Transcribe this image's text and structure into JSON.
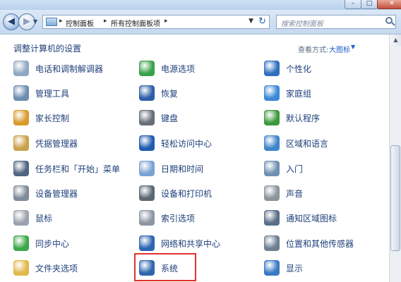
{
  "navbar": {
    "breadcrumbs": [
      "控制面板",
      "所有控制面板项"
    ],
    "search_placeholder": "搜索控制面板"
  },
  "header": {
    "title": "调整计算机的设置",
    "view_by_label": "查看方式:",
    "view_by_value": "大图标"
  },
  "items": [
    {
      "label": "电话和调制解调器",
      "icon": "phone-modem-icon",
      "color": "#8fa8c2"
    },
    {
      "label": "电源选项",
      "icon": "power-options-icon",
      "color": "#3aa14a"
    },
    {
      "label": "个性化",
      "icon": "personalization-icon",
      "color": "#2f6fbe"
    },
    {
      "label": "管理工具",
      "icon": "admin-tools-icon",
      "color": "#6e8db3"
    },
    {
      "label": "恢复",
      "icon": "recovery-icon",
      "color": "#2d5fa8"
    },
    {
      "label": "家庭组",
      "icon": "homegroup-icon",
      "color": "#3b89d6"
    },
    {
      "label": "家长控制",
      "icon": "parental-controls-icon",
      "color": "#d99a2b"
    },
    {
      "label": "键盘",
      "icon": "keyboard-icon",
      "color": "#666f7a"
    },
    {
      "label": "默认程序",
      "icon": "default-programs-icon",
      "color": "#3c9a3e"
    },
    {
      "label": "凭据管理器",
      "icon": "credential-manager-icon",
      "color": "#c9a14a"
    },
    {
      "label": "轻松访问中心",
      "icon": "ease-of-access-icon",
      "color": "#1f5cb0"
    },
    {
      "label": "区域和语言",
      "icon": "region-language-icon",
      "color": "#3f85c9"
    },
    {
      "label": "任务栏和「开始」菜单",
      "icon": "taskbar-icon",
      "color": "#4f6580"
    },
    {
      "label": "日期和时间",
      "icon": "date-time-icon",
      "color": "#7aa2d2"
    },
    {
      "label": "入门",
      "icon": "getting-started-icon",
      "color": "#6f8fb3"
    },
    {
      "label": "设备管理器",
      "icon": "device-manager-icon",
      "color": "#7f8b98"
    },
    {
      "label": "设备和打印机",
      "icon": "devices-printers-icon",
      "color": "#5c6774"
    },
    {
      "label": "声音",
      "icon": "sound-icon",
      "color": "#8b939b"
    },
    {
      "label": "鼠标",
      "icon": "mouse-icon",
      "color": "#9aa3ad"
    },
    {
      "label": "索引选项",
      "icon": "indexing-options-icon",
      "color": "#8c97a4"
    },
    {
      "label": "通知区域图标",
      "icon": "notification-icons-icon",
      "color": "#5a6f88"
    },
    {
      "label": "同步中心",
      "icon": "sync-center-icon",
      "color": "#3da84a"
    },
    {
      "label": "网络和共享中心",
      "icon": "network-sharing-icon",
      "color": "#2c64b4"
    },
    {
      "label": "位置和其他传感器",
      "icon": "location-sensors-icon",
      "color": "#6d7f93"
    },
    {
      "label": "文件夹选项",
      "icon": "folder-options-icon",
      "color": "#e2b84a"
    },
    {
      "label": "系统",
      "icon": "system-icon",
      "color": "#2f66ae"
    },
    {
      "label": "显示",
      "icon": "display-icon",
      "color": "#3b78c4"
    }
  ]
}
